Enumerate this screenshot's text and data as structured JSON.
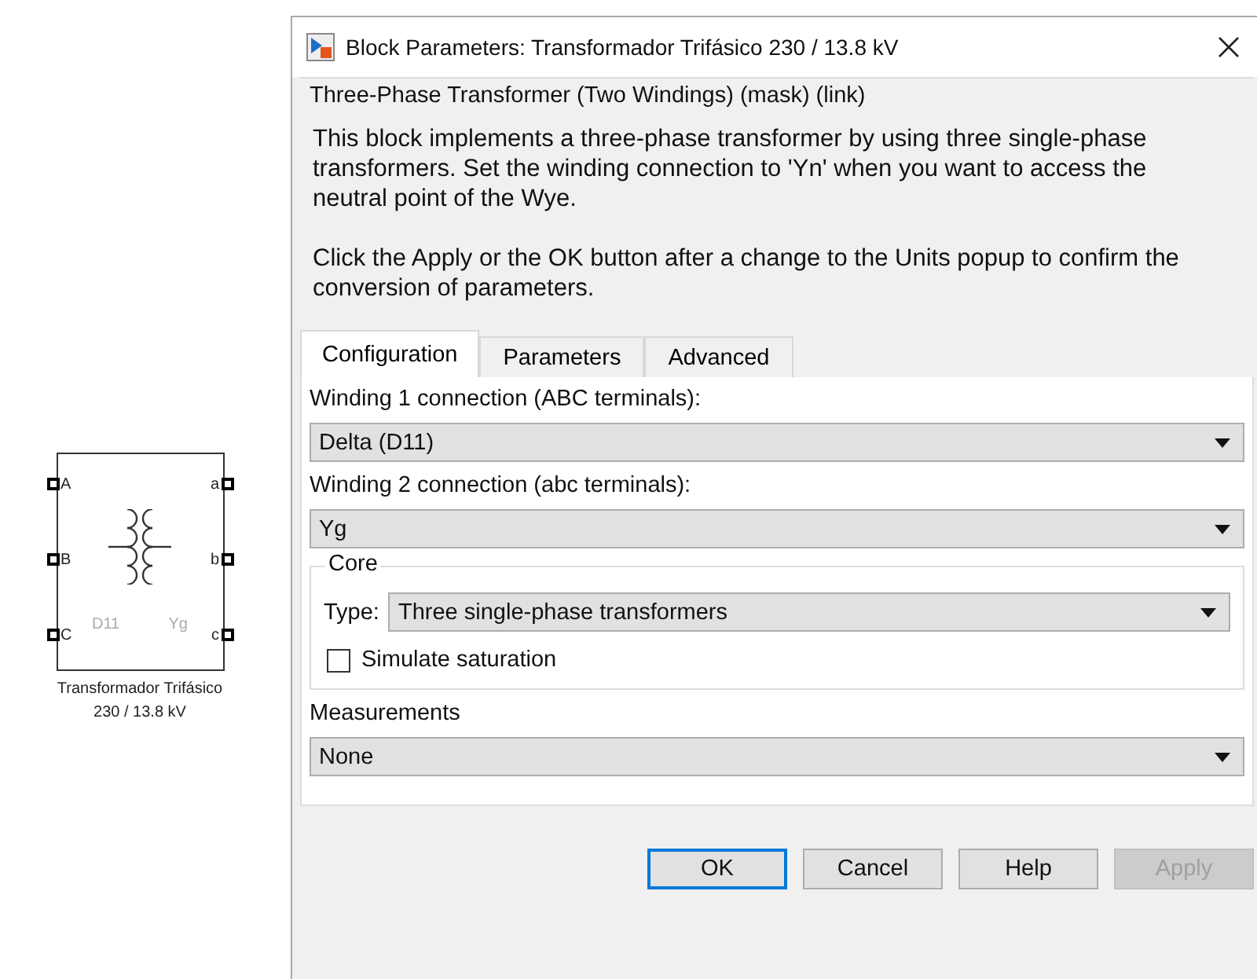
{
  "block": {
    "ports_left": [
      "A",
      "B",
      "C"
    ],
    "ports_right": [
      "a",
      "b",
      "c"
    ],
    "winding_labels": [
      "D11",
      "Yg"
    ],
    "name_lines": [
      "Transformador Trifásico",
      "230 / 13.8 kV"
    ]
  },
  "dialog": {
    "title": "Block Parameters: Transformador Trifásico 230 / 13.8 kV",
    "group_title": "Three-Phase Transformer (Two Windings) (mask) (link)",
    "description": [
      "This block implements a three-phase transformer by using three single-phase transformers. Set the winding connection to 'Yn'  when you want to access the neutral point of the Wye.",
      "Click the Apply or the OK button after a change to the Units popup to confirm the conversion of parameters."
    ],
    "tabs": [
      {
        "label": "Configuration",
        "selected": true
      },
      {
        "label": "Parameters",
        "selected": false
      },
      {
        "label": "Advanced",
        "selected": false
      }
    ],
    "fields": [
      {
        "kind": "dropdown",
        "label": "Winding 1 connection (ABC terminals):",
        "value": "Delta (D11)"
      },
      {
        "kind": "dropdown",
        "label": "Winding 2 connection (abc terminals):",
        "value": "Yg"
      },
      {
        "kind": "group",
        "title": "Core",
        "children": [
          {
            "kind": "inline-dropdown",
            "label": "Type:",
            "value": "Three single-phase transformers"
          },
          {
            "kind": "checkbox",
            "label": "Simulate saturation",
            "checked": false
          }
        ]
      },
      {
        "kind": "dropdown",
        "label": "Measurements",
        "value": "None"
      }
    ],
    "buttons": [
      {
        "label": "OK",
        "default": true,
        "disabled": false
      },
      {
        "label": "Cancel",
        "default": false,
        "disabled": false
      },
      {
        "label": "Help",
        "default": false,
        "disabled": false
      },
      {
        "label": "Apply",
        "default": false,
        "disabled": true
      }
    ]
  }
}
